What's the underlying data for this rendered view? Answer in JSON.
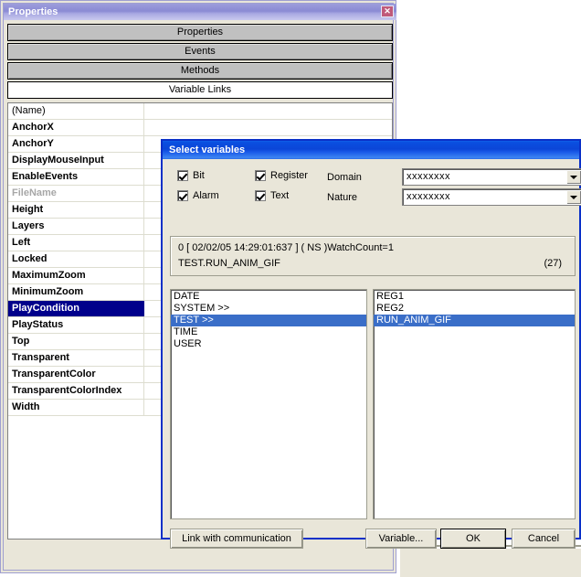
{
  "properties_window": {
    "title": "Properties",
    "close_label": "✕",
    "tabs": [
      {
        "label": "Properties",
        "active": false
      },
      {
        "label": "Events",
        "active": false
      },
      {
        "label": "Methods",
        "active": false
      },
      {
        "label": "Variable Links",
        "active": true
      }
    ],
    "grid": {
      "rows": [
        {
          "name": "(Name)",
          "value": "",
          "style": "plain"
        },
        {
          "name": "AnchorX",
          "value": "",
          "style": "bold"
        },
        {
          "name": "AnchorY",
          "value": "",
          "style": "bold"
        },
        {
          "name": "DisplayMouseInput",
          "value": "",
          "style": "bold"
        },
        {
          "name": "EnableEvents",
          "value": "",
          "style": "bold"
        },
        {
          "name": "FileName",
          "value": "",
          "style": "disabled"
        },
        {
          "name": "Height",
          "value": "",
          "style": "bold"
        },
        {
          "name": "Layers",
          "value": "",
          "style": "bold"
        },
        {
          "name": "Left",
          "value": "",
          "style": "bold"
        },
        {
          "name": "Locked",
          "value": "",
          "style": "bold"
        },
        {
          "name": "MaximumZoom",
          "value": "",
          "style": "bold"
        },
        {
          "name": "MinimumZoom",
          "value": "",
          "style": "bold"
        },
        {
          "name": "PlayCondition",
          "value": "",
          "style": "selected"
        },
        {
          "name": "PlayStatus",
          "value": "",
          "style": "bold"
        },
        {
          "name": "Top",
          "value": "",
          "style": "bold"
        },
        {
          "name": "Transparent",
          "value": "",
          "style": "bold"
        },
        {
          "name": "TransparentColor",
          "value": "",
          "style": "bold"
        },
        {
          "name": "TransparentColorIndex",
          "value": "",
          "style": "bold"
        },
        {
          "name": "Width",
          "value": "",
          "style": "bold"
        }
      ]
    }
  },
  "dialog": {
    "title": "Select variables",
    "filters": {
      "bit": {
        "label": "Bit",
        "checked": true
      },
      "alarm": {
        "label": "Alarm",
        "checked": true
      },
      "register": {
        "label": "Register",
        "checked": true
      },
      "text": {
        "label": "Text",
        "checked": true
      }
    },
    "domain": {
      "label": "Domain",
      "value": "xxxxxxxx"
    },
    "nature": {
      "label": "Nature",
      "value": "xxxxxxxx"
    },
    "info": {
      "line1": "0 [ 02/02/05 14:29:01:637 ]  ( NS )WatchCount=1",
      "line2": "TEST.RUN_ANIM_GIF",
      "count": "(27)"
    },
    "list_left": [
      {
        "label": "DATE",
        "selected": false
      },
      {
        "label": "SYSTEM >>",
        "selected": false
      },
      {
        "label": "TEST >>",
        "selected": true
      },
      {
        "label": "TIME",
        "selected": false
      },
      {
        "label": "USER",
        "selected": false
      }
    ],
    "list_right": [
      {
        "label": "REG1",
        "selected": false
      },
      {
        "label": "REG2",
        "selected": false
      },
      {
        "label": "RUN_ANIM_GIF",
        "selected": true
      }
    ],
    "buttons": {
      "link": "Link with communication",
      "variable": "Variable...",
      "ok": "OK",
      "cancel": "Cancel"
    }
  },
  "colors": {
    "active_title": "#0a4fe0",
    "inactive_title": "#8a8ad4",
    "dialog_face": "#e9e6d9",
    "selection_grid": "#00008b",
    "selection_list": "#3a6ec8",
    "dialog_border": "#0a30c8"
  }
}
